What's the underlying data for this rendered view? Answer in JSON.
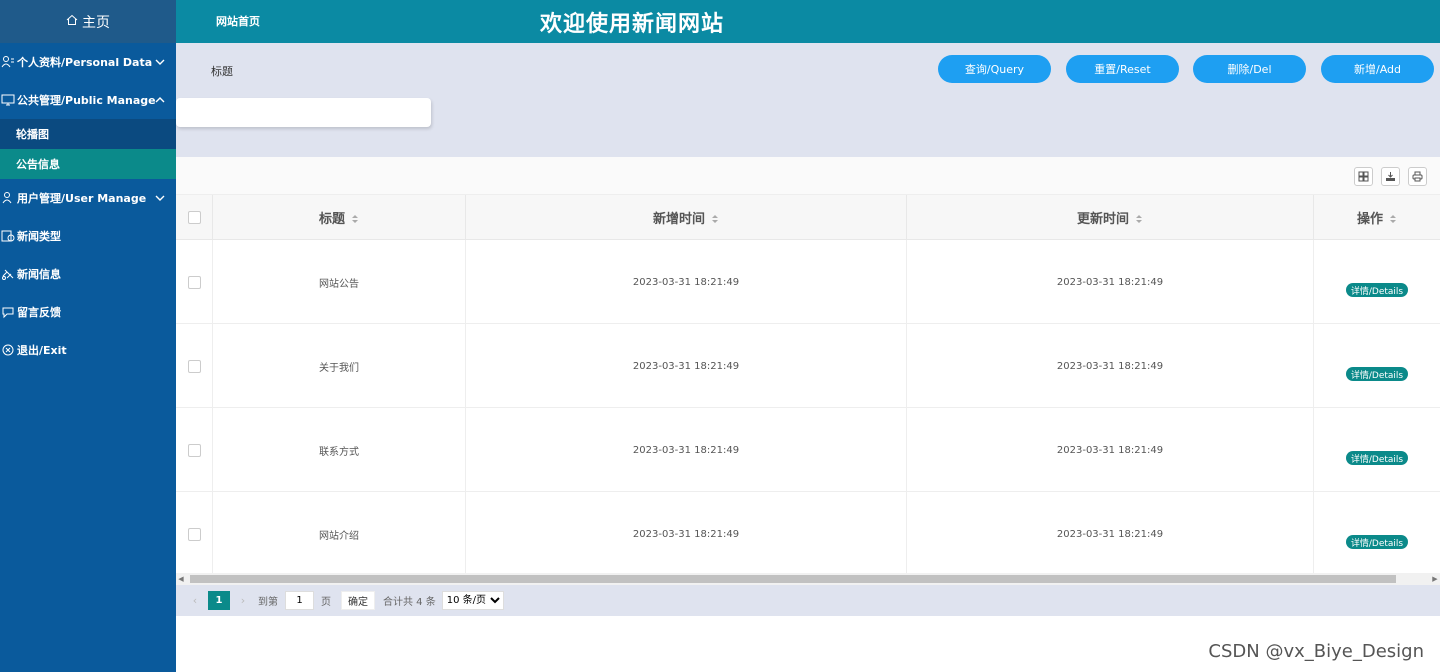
{
  "sidebar": {
    "home_label": "主页",
    "items": [
      {
        "label": "个人资料/Personal Data"
      },
      {
        "label": "公共管理/Public Manage"
      },
      {
        "label": "用户管理/User Manage"
      },
      {
        "label": "新闻类型"
      },
      {
        "label": "新闻信息"
      },
      {
        "label": "留言反馈"
      },
      {
        "label": "退出/Exit"
      }
    ],
    "sub_items": [
      {
        "label": "轮播图"
      },
      {
        "label": "公告信息"
      }
    ]
  },
  "header": {
    "breadcrumb": "网站首页",
    "title": "欢迎使用新闻网站"
  },
  "search": {
    "label": "标题",
    "value": "",
    "buttons": {
      "query": "查询/Query",
      "reset": "重置/Reset",
      "delete": "删除/Del",
      "add": "新增/Add"
    }
  },
  "table": {
    "columns": {
      "title": "标题",
      "created": "新增时间",
      "updated": "更新时间",
      "actions": "操作"
    },
    "rows": [
      {
        "title": "网站公告",
        "created": "2023-03-31 18:21:49",
        "updated": "2023-03-31 18:21:49",
        "action": "详情/Details"
      },
      {
        "title": "关于我们",
        "created": "2023-03-31 18:21:49",
        "updated": "2023-03-31 18:21:49",
        "action": "详情/Details"
      },
      {
        "title": "联系方式",
        "created": "2023-03-31 18:21:49",
        "updated": "2023-03-31 18:21:49",
        "action": "详情/Details"
      },
      {
        "title": "网站介绍",
        "created": "2023-03-31 18:21:49",
        "updated": "2023-03-31 18:21:49",
        "action": "详情/Details"
      }
    ]
  },
  "pagination": {
    "current": "1",
    "goto_label": "到第",
    "goto_value": "1",
    "page_label": "页",
    "confirm": "确定",
    "total": "合计共 4 条",
    "page_size": "10 条/页"
  },
  "watermark": "CSDN @vx_Biye_Design"
}
